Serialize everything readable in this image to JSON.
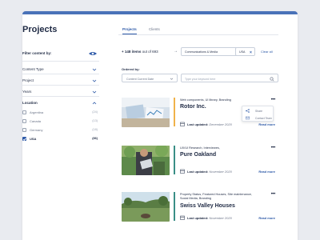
{
  "page": {
    "title": "Projects"
  },
  "tabs": [
    {
      "label": "Projects",
      "active": true
    },
    {
      "label": "Clients",
      "active": false
    }
  ],
  "sidebar": {
    "filter_label": "Filter content by:",
    "toggle_icon": "eye-icon",
    "sections": [
      {
        "label": "Content Type",
        "icon": "chevron-down-icon"
      },
      {
        "label": "Project",
        "icon": "chevron-down-icon"
      },
      {
        "label": "Years",
        "icon": "chevron-down-icon"
      }
    ],
    "location": {
      "label": "Location",
      "icon": "chevron-up-icon",
      "options": [
        {
          "name": "Argentina",
          "count": "(24)",
          "checked": false
        },
        {
          "name": "Canada",
          "count": "(13)",
          "checked": false
        },
        {
          "name": "Germany",
          "count": "(18)",
          "checked": false
        },
        {
          "name": "USA",
          "count": "(86)",
          "checked": true
        }
      ]
    }
  },
  "results": {
    "count_prefix": "+ 148 items",
    "count_suffix": " out of 693",
    "arrow": "→",
    "chips": [
      {
        "label": "Communications & Media"
      },
      {
        "label": "USA"
      }
    ],
    "clear_all": "Clear all"
  },
  "controls": {
    "ordered_by_label": "Ordered by:",
    "select_value": "Content Current Date",
    "search_placeholder": "Type your keyword here"
  },
  "items": [
    {
      "tags": "Web components, UI library, Branding",
      "title": "Rotor Inc.",
      "updated_label": "Last updated:",
      "updated_date": "December 2020",
      "read_more": "Read more",
      "accent": "#f0b24a"
    },
    {
      "tags": "UX/UI Research, Interviewes,",
      "title": "Pure Oakland",
      "updated_label": "Last updated:",
      "updated_date": "November 2020",
      "read_more": "Read more",
      "accent": "#3a8f86"
    },
    {
      "tags": "Property Status, Featured Houses, Site maintenance, Social Media, Branding",
      "title": "Swiss Valley Houses",
      "updated_label": "Last updated:",
      "updated_date": "November 2020",
      "read_more": "Read more",
      "accent": "#3a8f86"
    }
  ],
  "share_menu": {
    "items": [
      {
        "label": "Share",
        "icon": "share-icon"
      },
      {
        "label": "Contact Team",
        "icon": "mail-icon"
      }
    ]
  },
  "colors": {
    "brand": "#2e5aa8",
    "top_bar": "#4a72b8",
    "background": "#e9ebf0",
    "text": "#1f2a44"
  }
}
